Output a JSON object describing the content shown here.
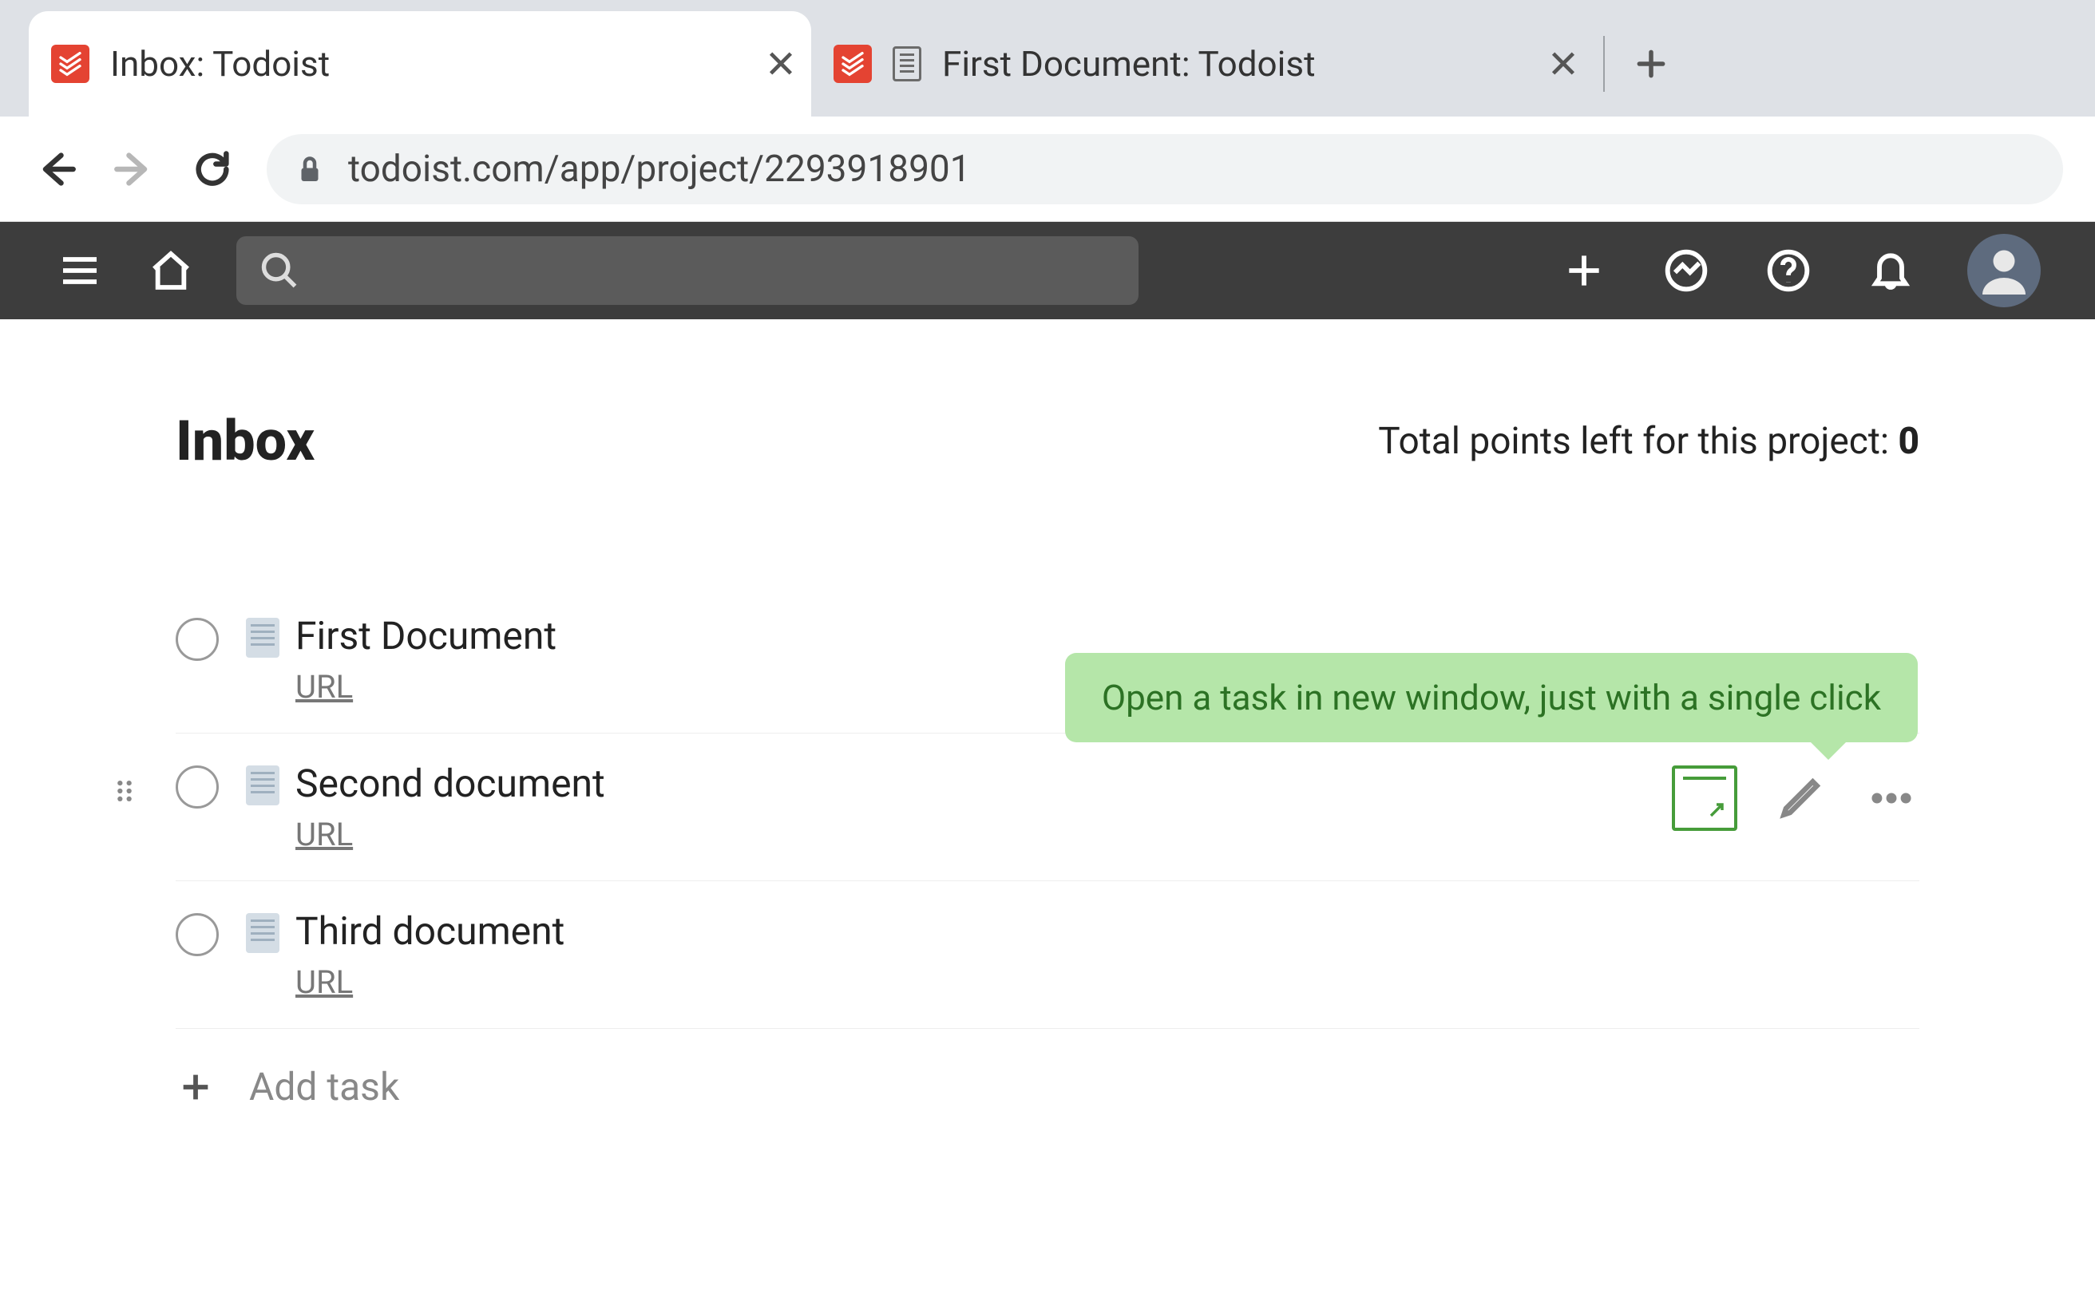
{
  "browser": {
    "tabs": [
      {
        "title": "Inbox: Todoist",
        "active": true
      },
      {
        "title": "First Document: Todoist",
        "active": false
      }
    ],
    "url": "todoist.com/app/project/2293918901"
  },
  "header": {
    "search_placeholder": ""
  },
  "page": {
    "title": "Inbox",
    "points_label": "Total points left for this project: ",
    "points_value": "0"
  },
  "tasks": [
    {
      "title": "First Document",
      "url_label": "URL"
    },
    {
      "title": "Second document",
      "url_label": "URL"
    },
    {
      "title": "Third document",
      "url_label": "URL"
    }
  ],
  "tooltip": {
    "text": "Open a task in new window, just with a single click"
  },
  "add_task_label": "Add task"
}
